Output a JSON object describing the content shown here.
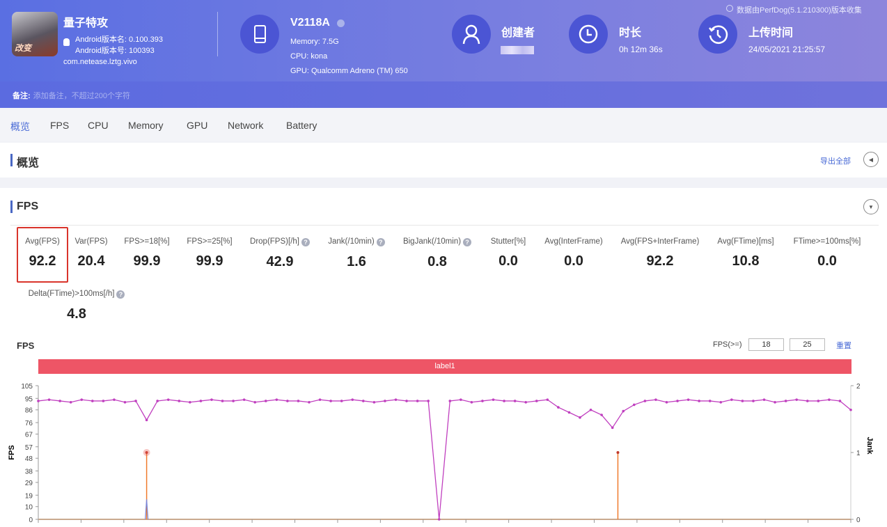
{
  "app": {
    "name": "量子特攻",
    "version_name": "Android版本名: 0.100.393",
    "version_code": "Android版本号: 100393",
    "package": "com.netease.lztg.vivo",
    "icon_text": "改变"
  },
  "device": {
    "model": "V2118A",
    "memory": "Memory: 7.5G",
    "cpu": "CPU: kona",
    "gpu": "GPU: Qualcomm Adreno (TM) 650"
  },
  "creator": {
    "label": "创建者"
  },
  "duration": {
    "label": "时长",
    "value": "0h 12m 36s"
  },
  "upload": {
    "label": "上传时间",
    "value": "24/05/2021 21:25:57"
  },
  "collected_by": "数据由PerfDog(5.1.210300)版本收集",
  "note": {
    "label": "备注:",
    "placeholder": "添加备注，不超过200个字符"
  },
  "tabs": [
    "概览",
    "FPS",
    "CPU",
    "Memory",
    "GPU",
    "Network",
    "Battery"
  ],
  "overview": {
    "title": "概览",
    "export": "导出全部"
  },
  "fps_section": {
    "title": "FPS",
    "metrics": [
      {
        "label": "Avg(FPS)",
        "value": "92.2"
      },
      {
        "label": "Var(FPS)",
        "value": "20.4"
      },
      {
        "label": "FPS>=18[%]",
        "value": "99.9"
      },
      {
        "label": "FPS>=25[%]",
        "value": "99.9"
      },
      {
        "label": "Drop(FPS)[/h]",
        "value": "42.9",
        "help": true
      },
      {
        "label": "Jank(/10min)",
        "value": "1.6",
        "help": true
      },
      {
        "label": "BigJank(/10min)",
        "value": "0.8",
        "help": true
      },
      {
        "label": "Stutter[%]",
        "value": "0.0"
      },
      {
        "label": "Avg(InterFrame)",
        "value": "0.0"
      },
      {
        "label": "Avg(FPS+InterFrame)",
        "value": "92.2"
      },
      {
        "label": "Avg(FTime)[ms]",
        "value": "10.8"
      },
      {
        "label": "FTime>=100ms[%]",
        "value": "0.0"
      },
      {
        "label": "Delta(FTime)>100ms[/h]",
        "value": "4.8",
        "help": true
      }
    ],
    "help_glyph": "?",
    "chart_title": "FPS",
    "threshold_label": "FPS(>=)",
    "threshold_1": "18",
    "threshold_2": "25",
    "reset": "重置",
    "label_bar": "label1"
  },
  "chart_data": {
    "type": "line",
    "ylabel": "FPS",
    "y2label": "Jank",
    "ylim": [
      0,
      105
    ],
    "yticks": [
      0,
      10,
      19,
      29,
      38,
      48,
      57,
      67,
      76,
      86,
      95,
      105
    ],
    "y2lim": [
      0,
      2
    ],
    "y2ticks": [
      0,
      1,
      2
    ],
    "x_seconds_step": 10,
    "fps": [
      93,
      94,
      93,
      92,
      94,
      93,
      93,
      94,
      92,
      93,
      78,
      93,
      94,
      93,
      92,
      93,
      94,
      93,
      93,
      94,
      92,
      93,
      94,
      93,
      93,
      92,
      94,
      93,
      93,
      94,
      93,
      92,
      93,
      94,
      93,
      93,
      93,
      0,
      93,
      94,
      92,
      93,
      94,
      93,
      93,
      92,
      93,
      94,
      88,
      84,
      80,
      86,
      82,
      72,
      85,
      90,
      93,
      94,
      92,
      93,
      94,
      93,
      93,
      92,
      94,
      93,
      93,
      94,
      92,
      93,
      94,
      93,
      93,
      94,
      93,
      86
    ],
    "jank": [
      {
        "t": 100,
        "v": 1
      },
      {
        "t": 535,
        "v": 1
      }
    ],
    "bigjank": [
      {
        "t": 100,
        "v": 0.3
      }
    ],
    "colors": {
      "fps": "#c03fbf",
      "jank": "#f07b2c",
      "bigjank": "#7a86d8",
      "label_bar": "#ee5566",
      "accent": "#4a6bd6"
    }
  }
}
